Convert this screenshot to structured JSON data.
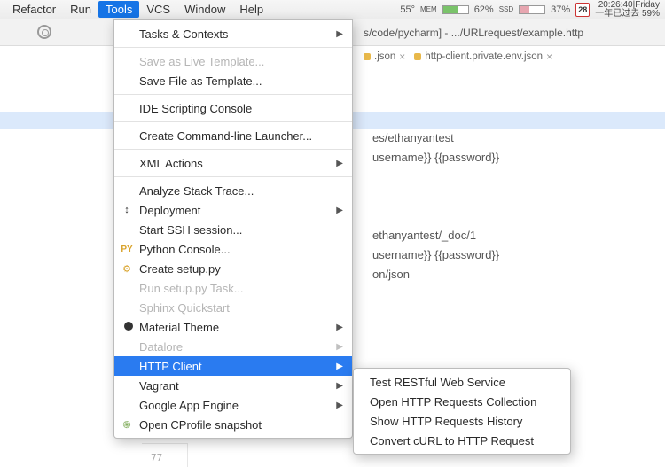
{
  "menubar": {
    "items": [
      "Refactor",
      "Run",
      "Tools",
      "VCS",
      "Window",
      "Help"
    ],
    "active_index": 2
  },
  "statusbar": {
    "temp": "55°",
    "mem_label": "MEM",
    "mem_pct": "62%",
    "ssd_label": "SSD",
    "ssd_pct": "37%",
    "cal_day": "28",
    "clock_line1": "20:26:40|Friday",
    "clock_line2": "一年已过去 59%"
  },
  "window": {
    "title": "s/code/pycharm] - .../URLrequest/example.http"
  },
  "tabs": {
    "t1_label": ".json",
    "t2_label": "http-client.private.env.json"
  },
  "tools_menu": {
    "tasks": "Tasks & Contexts",
    "save_live": "Save as Live Template...",
    "save_file": "Save File as Template...",
    "ide_script": "IDE Scripting Console",
    "cmd_launcher": "Create Command-line Launcher...",
    "xml": "XML Actions",
    "stack": "Analyze Stack Trace...",
    "deploy": "Deployment",
    "ssh": "Start SSH session...",
    "pyconsole": "Python Console...",
    "setup": "Create setup.py",
    "run_setup": "Run setup.py Task...",
    "sphinx": "Sphinx Quickstart",
    "material": "Material Theme",
    "datalore": "Datalore",
    "http": "HTTP Client",
    "vagrant": "Vagrant",
    "gae": "Google App Engine",
    "cprofile": "Open CProfile snapshot"
  },
  "http_submenu": {
    "i1": "Test RESTful Web Service",
    "i2": "Open HTTP Requests Collection",
    "i3": "Show HTTP Requests History",
    "i4": "Convert cURL to HTTP Request"
  },
  "code": {
    "l1": "es/ethanyantest",
    "l2": "username}} {{password}}",
    "l3": "ethanyantest/_doc/1",
    "l4": "username}} {{password}}",
    "l5": "on/json"
  },
  "gutter": {
    "line_num": "77"
  }
}
